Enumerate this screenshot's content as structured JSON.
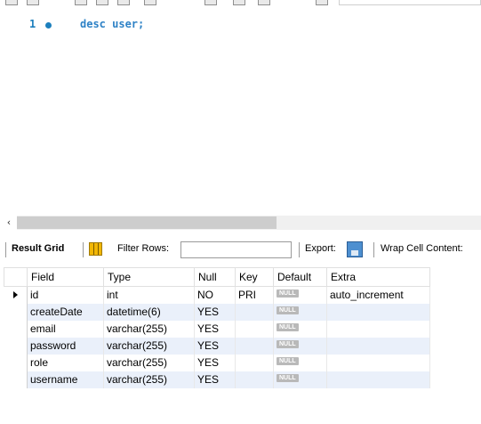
{
  "editor": {
    "lines": [
      {
        "number": "1",
        "code": "desc user;"
      }
    ]
  },
  "result_toolbar": {
    "result_grid_label": "Result Grid",
    "filter_rows_label": "Filter Rows:",
    "filter_value": "",
    "export_label": "Export:",
    "wrap_label": "Wrap Cell Content:"
  },
  "grid": {
    "columns": [
      "Field",
      "Type",
      "Null",
      "Key",
      "Default",
      "Extra"
    ],
    "null_badge": "NULL",
    "rows": [
      {
        "field": "id",
        "type": "int",
        "null": "NO",
        "key": "PRI",
        "extra": "auto_increment"
      },
      {
        "field": "createDate",
        "type": "datetime(6)",
        "null": "YES",
        "key": "",
        "extra": ""
      },
      {
        "field": "email",
        "type": "varchar(255)",
        "null": "YES",
        "key": "",
        "extra": ""
      },
      {
        "field": "password",
        "type": "varchar(255)",
        "null": "YES",
        "key": "",
        "extra": ""
      },
      {
        "field": "role",
        "type": "varchar(255)",
        "null": "YES",
        "key": "",
        "extra": ""
      },
      {
        "field": "username",
        "type": "varchar(255)",
        "null": "YES",
        "key": "",
        "extra": ""
      }
    ]
  },
  "colors": {
    "keyword": "#2e82c6",
    "alt_row": "#eaf0fa",
    "null_badge": "#b9b9b9"
  }
}
